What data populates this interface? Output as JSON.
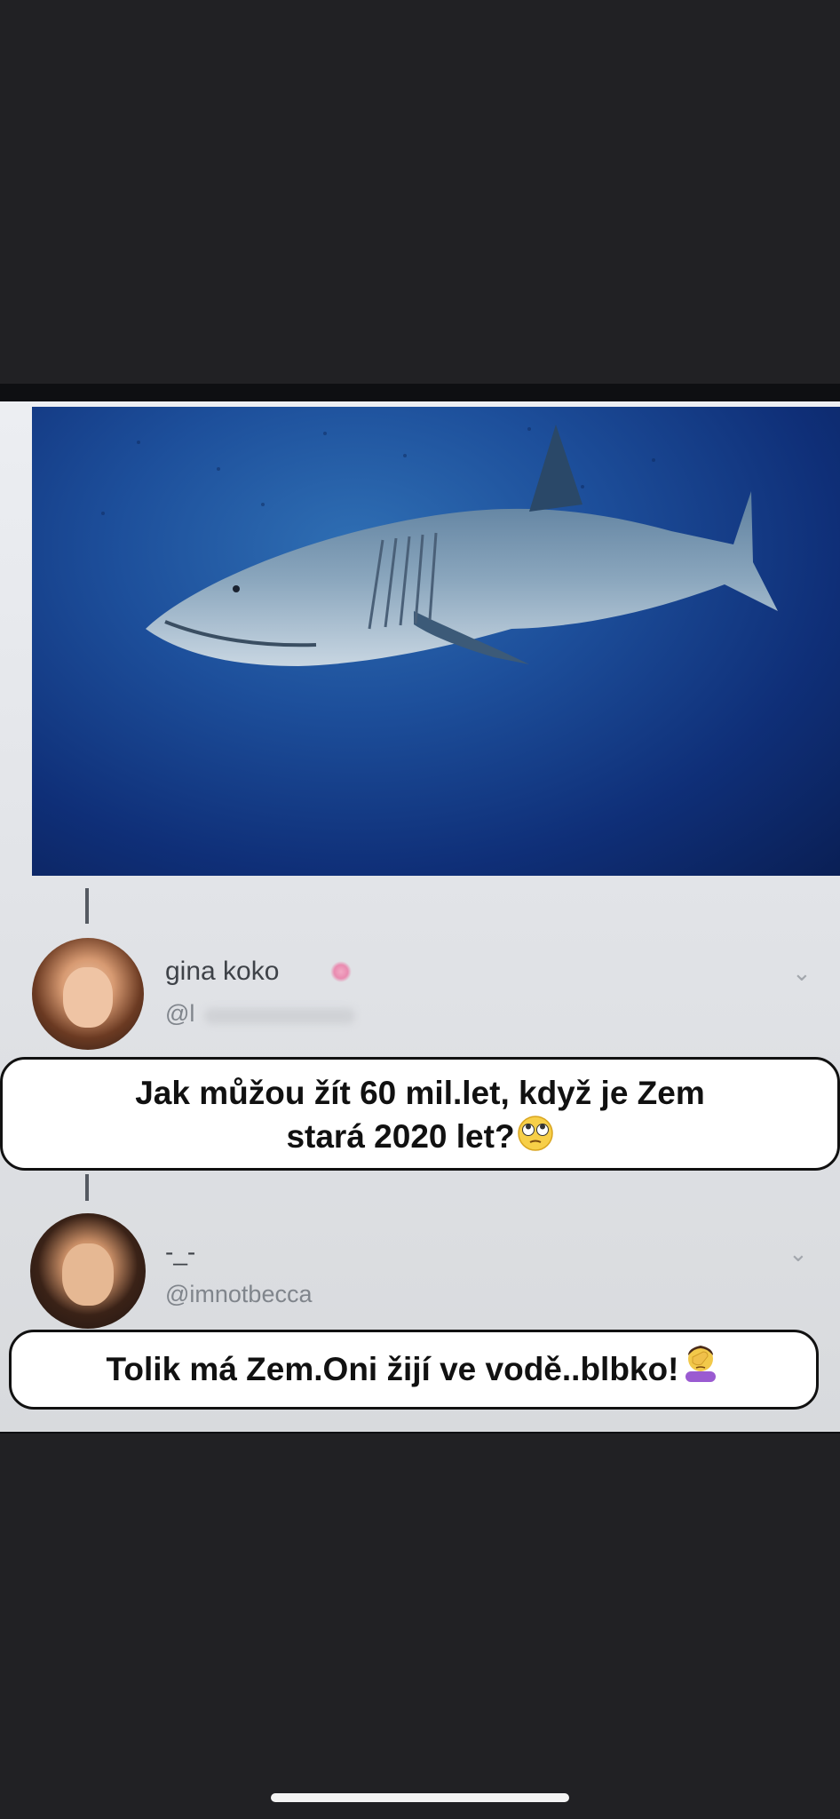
{
  "post1": {
    "username": "gina koko",
    "handle": "@l"
  },
  "caption1": {
    "line1": "Jak můžou žít 60 mil.let, když je Zem",
    "line2": "stará 2020 let?",
    "emoji": "eye-roll-emoji"
  },
  "post2": {
    "username": "-_-",
    "handle": "@imnotbecca"
  },
  "caption2": {
    "text": "Tolik má Zem.Oni žijí ve vodě..blbko!",
    "emoji": "facepalm-emoji"
  },
  "colors": {
    "background": "#212124",
    "ocean": "#1d4f9b",
    "caption_bg": "#ffffff"
  }
}
